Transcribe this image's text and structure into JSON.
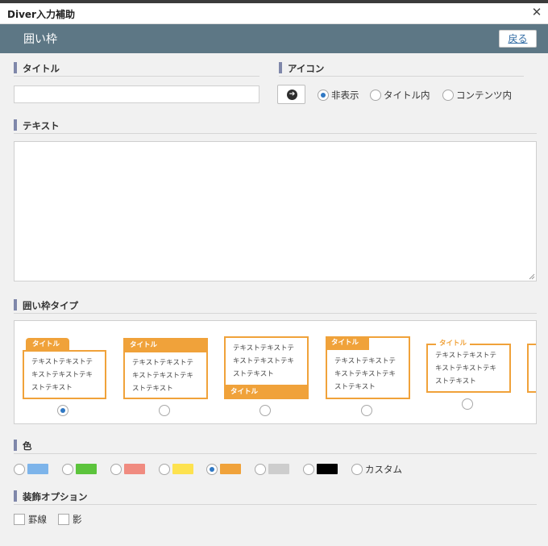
{
  "window": {
    "title": "Diver入力補助"
  },
  "header": {
    "title": "囲い枠",
    "back_label": "戻る"
  },
  "sections": {
    "title": "タイトル",
    "icon": "アイコン",
    "text": "テキスト",
    "frame_type": "囲い枠タイプ",
    "color": "色",
    "decor": "装飾オプション"
  },
  "icon_options": [
    {
      "label": "非表示",
      "selected": true
    },
    {
      "label": "タイトル内",
      "selected": false
    },
    {
      "label": "コンテンツ内",
      "selected": false
    }
  ],
  "frame_samples": {
    "tag_label": "タイトル",
    "body_lines": [
      "テキストテキストテ",
      "キストテキストテキ",
      "ストテキスト"
    ],
    "selected_index": 0
  },
  "colors": {
    "swatches": [
      "#7db4ea",
      "#5cc43c",
      "#f08b80",
      "#fde24f",
      "#f0a23a",
      "#cdcdcd",
      "#000000"
    ],
    "selected_index": 4,
    "custom_label": "カスタム"
  },
  "decor_options": [
    "罫線",
    "影"
  ]
}
